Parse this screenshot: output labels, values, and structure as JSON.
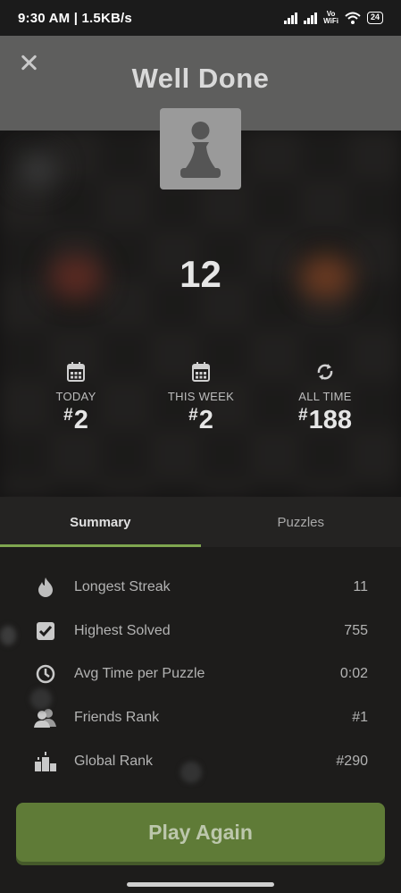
{
  "status_bar": {
    "time": "9:30 AM | 1.5KB/s",
    "network": "Vo\nWiFi",
    "battery": "24"
  },
  "header": {
    "title": "Well Done"
  },
  "score": "12",
  "ranks": [
    {
      "label": "TODAY",
      "prefix": "#",
      "value": "2",
      "icon": "calendar-icon"
    },
    {
      "label": "THIS WEEK",
      "prefix": "#",
      "value": "2",
      "icon": "calendar-icon"
    },
    {
      "label": "ALL TIME",
      "prefix": "#",
      "value": "188",
      "icon": "refresh-icon"
    }
  ],
  "tabs": [
    {
      "label": "Summary",
      "active": true
    },
    {
      "label": "Puzzles",
      "active": false
    }
  ],
  "stats": [
    {
      "label": "Longest Streak",
      "value": "11",
      "icon": "flame-icon"
    },
    {
      "label": "Highest Solved",
      "value": "755",
      "icon": "checkbox-icon"
    },
    {
      "label": "Avg Time per Puzzle",
      "value": "0:02",
      "icon": "clock-icon"
    },
    {
      "label": "Friends Rank",
      "value": "#1",
      "icon": "friends-icon"
    },
    {
      "label": "Global Rank",
      "value": "#290",
      "icon": "podium-icon"
    }
  ],
  "play_again_label": "Play Again",
  "colors": {
    "accent_green": "#7fa650",
    "button_green": "#5f7b37",
    "header_gray": "#5e5e5d"
  }
}
